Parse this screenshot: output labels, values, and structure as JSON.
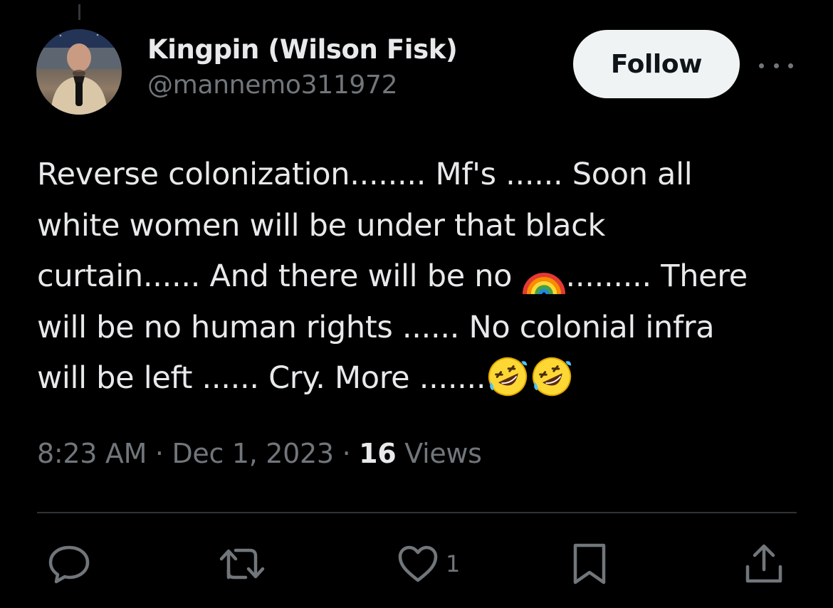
{
  "author": {
    "name": "Kingpin (Wilson Fisk)",
    "handle": "@mannemo311972"
  },
  "follow_label": "Follow",
  "tweet": {
    "lines": [
      "Reverse colonization........ Mf's ...... Soon all",
      "white women will be under that black",
      [
        "curtain...... And there will be no ",
        "......... There"
      ],
      "will be no human rights ...... No colonial infra",
      "will be left ...... Cry. More ......."
    ],
    "emojis": [
      "rainbow-emoji",
      "rolling-laughing-emoji",
      "rolling-laughing-emoji"
    ]
  },
  "meta": {
    "time": "8:23 AM",
    "separator": "·",
    "date": "Dec 1, 2023",
    "views_count": "16",
    "views_label": "Views"
  },
  "actions": {
    "like_count": "1"
  },
  "colors": {
    "background": "#000000",
    "primary_text": "#e7e9ea",
    "secondary_text": "#71767b",
    "follow_bg": "#eff3f4",
    "divider": "#2f3336"
  },
  "icons": [
    "avatar",
    "more-icon",
    "reply-icon",
    "retweet-icon",
    "like-icon",
    "bookmark-icon",
    "share-icon"
  ]
}
